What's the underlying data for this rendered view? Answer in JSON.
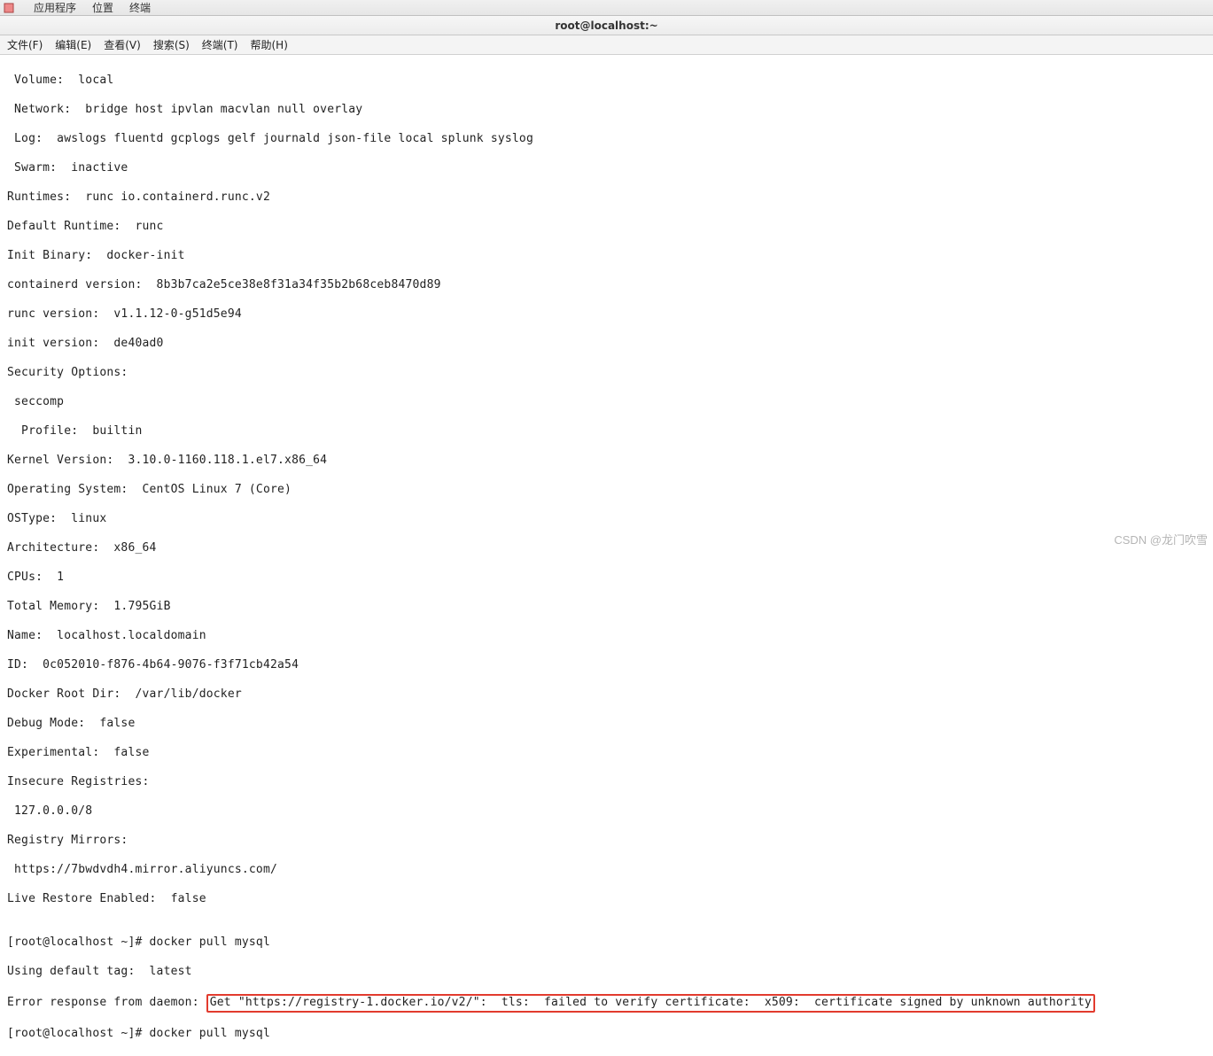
{
  "panel": {
    "apps": "应用程序",
    "places": "位置",
    "terminal": "终端"
  },
  "window": {
    "title": "root@localhost:~"
  },
  "menu": {
    "file": "文件(F)",
    "edit": "编辑(E)",
    "view": "查看(V)",
    "search": "搜索(S)",
    "terminal": "终端(T)",
    "help": "帮助(H)"
  },
  "term": {
    "l01": " Volume:  local",
    "l02": " Network:  bridge host ipvlan macvlan null overlay",
    "l03": " Log:  awslogs fluentd gcplogs gelf journald json-file local splunk syslog",
    "l04": " Swarm:  inactive",
    "l05": "Runtimes:  runc io.containerd.runc.v2",
    "l06": "Default Runtime:  runc",
    "l07": "Init Binary:  docker-init",
    "l08": "containerd version:  8b3b7ca2e5ce38e8f31a34f35b2b68ceb8470d89",
    "l09": "runc version:  v1.1.12-0-g51d5e94",
    "l10": "init version:  de40ad0",
    "l11": "Security Options:",
    "l12": " seccomp",
    "l13": "  Profile:  builtin",
    "l14": "Kernel Version:  3.10.0-1160.118.1.el7.x86_64",
    "l15": "Operating System:  CentOS Linux 7 (Core)",
    "l16": "OSType:  linux",
    "l17": "Architecture:  x86_64",
    "l18": "CPUs:  1",
    "l19": "Total Memory:  1.795GiB",
    "l20": "Name:  localhost.localdomain",
    "l21": "ID:  0c052010-f876-4b64-9076-f3f71cb42a54",
    "l22": "Docker Root Dir:  /var/lib/docker",
    "l23": "Debug Mode:  false",
    "l24": "Experimental:  false",
    "l25": "Insecure Registries:",
    "l26": " 127.0.0.0/8",
    "l27": "Registry Mirrors:",
    "l28": " https://7bwdvdh4.mirror.aliyuncs.com/",
    "l29": "Live Restore Enabled:  false",
    "l30": "",
    "l31": "[root@localhost ~]# docker pull mysql",
    "l32": "Using default tag:  latest",
    "err_prefix": "Error response from daemon: ",
    "err_body": "Get \"https://registry-1.docker.io/v2/\":  tls:  failed to verify certificate:  x509:  certificate signed by unknown authority",
    "l34": "[root@localhost ~]# docker pull mysql"
  },
  "watermark": "CSDN @龙门吹雪"
}
